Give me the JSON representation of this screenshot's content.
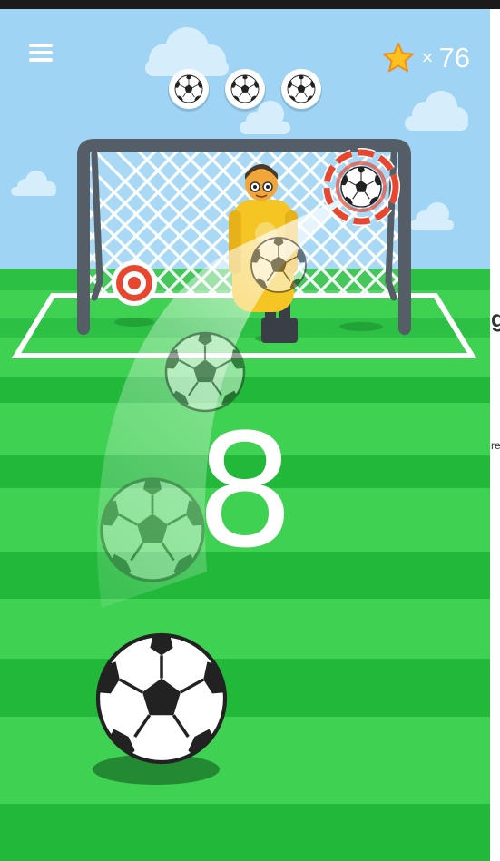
{
  "hud": {
    "menu_icon": "hamburger-menu-icon",
    "star_icon": "star-icon",
    "multiplier": "×",
    "stars_count": "76",
    "balls_remaining": 3
  },
  "countdown": "8",
  "side_strip": {
    "letters": [
      "g",
      "re"
    ]
  },
  "colors": {
    "sky": "#9fd4f5",
    "grass_light": "#3fd152",
    "grass_dark": "#22b93b",
    "net_frame": "#555e66",
    "target_red": "#e8472f",
    "keeper_shirt": "#f5c524",
    "star": "#ffc21f"
  }
}
